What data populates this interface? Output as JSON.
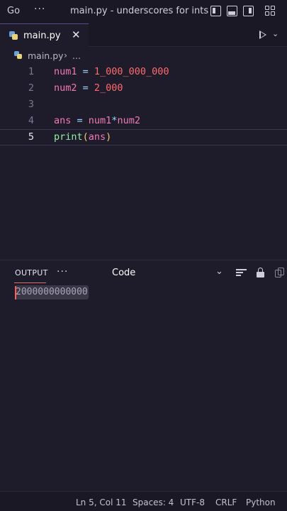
{
  "titlebar": {
    "menu_go": "Go",
    "overflow": "···",
    "title": "main.py - underscores for ints - V..."
  },
  "tab": {
    "label": "main.py",
    "close": "✕"
  },
  "breadcrumb": {
    "file": "main.py",
    "separator": "›",
    "ellipsis": "..."
  },
  "editor": {
    "lines": [
      {
        "num": "1",
        "tokens": [
          "num1",
          " = ",
          "1_000_000_000"
        ]
      },
      {
        "num": "2",
        "tokens": [
          "num2",
          " = ",
          "2_000"
        ]
      },
      {
        "num": "3",
        "tokens": []
      },
      {
        "num": "4",
        "tokens": [
          "ans",
          " = ",
          "num1",
          "*",
          "num2"
        ]
      },
      {
        "num": "5",
        "tokens": [
          "print",
          "(",
          "ans",
          ")"
        ]
      }
    ],
    "active_line": "5"
  },
  "panel": {
    "tab_label": "OUTPUT",
    "overflow": "···",
    "select_value": "Code",
    "output": "2000000000000"
  },
  "statusbar": {
    "position": "Ln 5, Col 11",
    "spaces": "Spaces: 4",
    "encoding": "UTF-8",
    "eol": "CRLF",
    "language": "Python"
  },
  "colors": {
    "background": "#1e1b2b",
    "variable": "#f07ab4",
    "number": "#ff6b6b",
    "function": "#8ff0a4",
    "paren": "#f7c96b",
    "operator": "#9fd5ff"
  }
}
